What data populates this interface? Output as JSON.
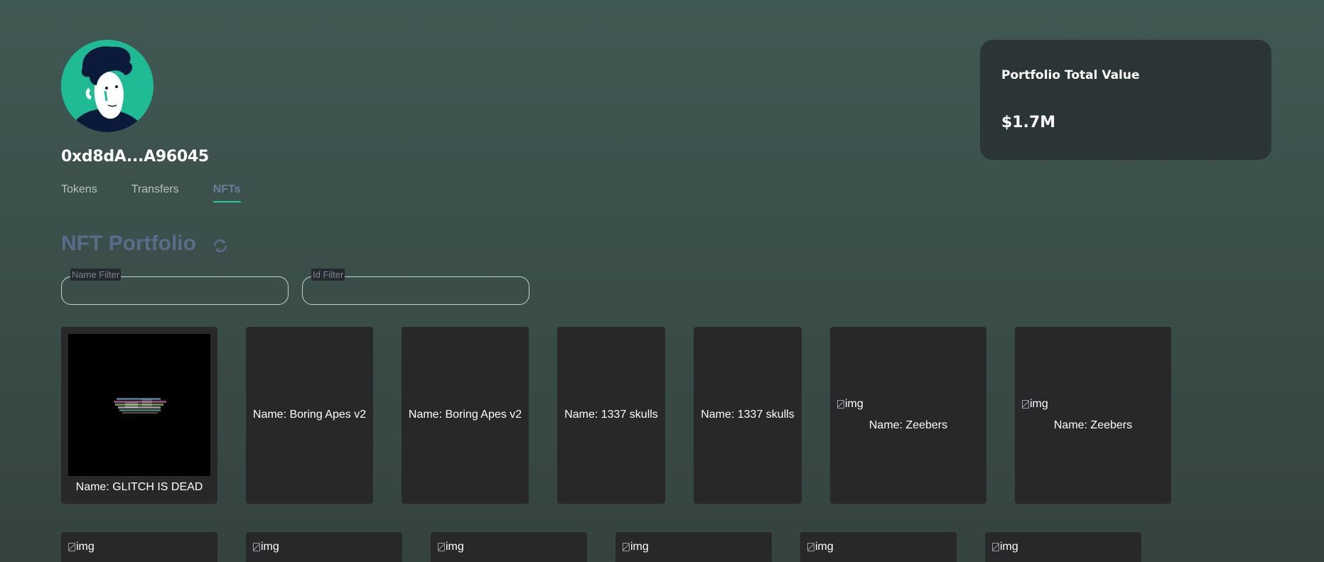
{
  "profile": {
    "address": "0xd8dA...A96045"
  },
  "tabs": [
    {
      "label": "Tokens",
      "active": false
    },
    {
      "label": "Transfers",
      "active": false
    },
    {
      "label": "NFTs",
      "active": true
    }
  ],
  "portfolio": {
    "title": "Portfolio Total Value",
    "value": "$1.7M"
  },
  "nft_section": {
    "title": "NFT Portfolio",
    "name_filter": {
      "label": "Name Filter",
      "value": ""
    },
    "id_filter": {
      "label": "Id Filter",
      "value": ""
    }
  },
  "nfts_row1": [
    {
      "name": "Name: GLITCH IS DEAD",
      "image": "glitch"
    },
    {
      "name": "Name: Boring Apes v2",
      "image": "none"
    },
    {
      "name": "Name: Boring Apes v2",
      "image": "none"
    },
    {
      "name": "Name: 1337 skulls",
      "image": "none"
    },
    {
      "name": "Name: 1337 skulls",
      "image": "none"
    },
    {
      "name": "Name: Zeebers",
      "image": "broken"
    },
    {
      "name": "Name: Zeebers",
      "image": "broken"
    }
  ],
  "nfts_row2": [
    {
      "alt": "img"
    },
    {
      "alt": "img"
    },
    {
      "alt": "img"
    },
    {
      "alt": "img"
    },
    {
      "alt": "img"
    },
    {
      "alt": "img"
    }
  ],
  "colors": {
    "accent": "#22c8a0",
    "card_bg": "#28282b",
    "panel_bg": "#2c3535",
    "section_title": "#5b6b89"
  }
}
